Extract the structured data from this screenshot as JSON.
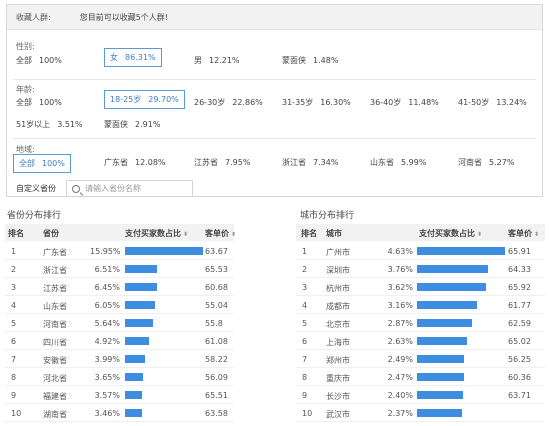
{
  "filter": {
    "header_title": "收藏人群:",
    "header_hint": "您目前可以收藏5个人群!",
    "gender": {
      "label": "性别:",
      "options": [
        {
          "name": "全部",
          "value": "100%"
        },
        {
          "name": "女",
          "value": "86.31%",
          "selected": true
        },
        {
          "name": "男",
          "value": "12.21%"
        },
        {
          "name": "蒙面侠",
          "value": "1.48%"
        }
      ]
    },
    "age": {
      "label": "年龄:",
      "options": [
        {
          "name": "全部",
          "value": "100%"
        },
        {
          "name": "18-25岁",
          "value": "29.70%",
          "selected": true
        },
        {
          "name": "26-30岁",
          "value": "22.86%"
        },
        {
          "name": "31-35岁",
          "value": "16.30%"
        },
        {
          "name": "36-40岁",
          "value": "11.48%"
        },
        {
          "name": "41-50岁",
          "value": "13.24%"
        },
        {
          "name": "51岁以上",
          "value": "3.51%"
        },
        {
          "name": "蒙面侠",
          "value": "2.91%"
        }
      ]
    },
    "region": {
      "label": "地域:",
      "options": [
        {
          "name": "全部",
          "value": "100%",
          "selected": true
        },
        {
          "name": "广东省",
          "value": "12.08%"
        },
        {
          "name": "江苏省",
          "value": "7.95%"
        },
        {
          "name": "浙江省",
          "value": "7.34%"
        },
        {
          "name": "山东省",
          "value": "5.99%"
        },
        {
          "name": "河南省",
          "value": "5.27%"
        }
      ]
    },
    "custom_province_label": "自定义省份",
    "search_placeholder": "请输入省份名称"
  },
  "province_table": {
    "title": "省份分布排行",
    "headers": {
      "rank": "排名",
      "name": "省份",
      "pct": "支付买家数占比",
      "price": "客单价"
    },
    "rows": [
      {
        "rank": "1",
        "name": "广东省",
        "pct": "15.95%",
        "pct_value": 15.95,
        "price": "63.67"
      },
      {
        "rank": "2",
        "name": "浙江省",
        "pct": "6.51%",
        "pct_value": 6.51,
        "price": "65.53"
      },
      {
        "rank": "3",
        "name": "江苏省",
        "pct": "6.45%",
        "pct_value": 6.45,
        "price": "60.68"
      },
      {
        "rank": "4",
        "name": "山东省",
        "pct": "6.05%",
        "pct_value": 6.05,
        "price": "55.04"
      },
      {
        "rank": "5",
        "name": "河南省",
        "pct": "5.64%",
        "pct_value": 5.64,
        "price": "55.8"
      },
      {
        "rank": "6",
        "name": "四川省",
        "pct": "4.92%",
        "pct_value": 4.92,
        "price": "61.08"
      },
      {
        "rank": "7",
        "name": "安徽省",
        "pct": "3.99%",
        "pct_value": 3.99,
        "price": "58.22"
      },
      {
        "rank": "8",
        "name": "河北省",
        "pct": "3.65%",
        "pct_value": 3.65,
        "price": "56.09"
      },
      {
        "rank": "9",
        "name": "福建省",
        "pct": "3.57%",
        "pct_value": 3.57,
        "price": "65.51"
      },
      {
        "rank": "10",
        "name": "湖南省",
        "pct": "3.46%",
        "pct_value": 3.46,
        "price": "63.58"
      }
    ]
  },
  "city_table": {
    "title": "城市分布排行",
    "headers": {
      "rank": "排名",
      "name": "城市",
      "pct": "支付买家数占比",
      "price": "客单价"
    },
    "rows": [
      {
        "rank": "1",
        "name": "广州市",
        "pct": "4.63%",
        "pct_value": 4.63,
        "price": "65.91"
      },
      {
        "rank": "2",
        "name": "深圳市",
        "pct": "3.76%",
        "pct_value": 3.76,
        "price": "64.33"
      },
      {
        "rank": "3",
        "name": "杭州市",
        "pct": "3.62%",
        "pct_value": 3.62,
        "price": "65.92"
      },
      {
        "rank": "4",
        "name": "成都市",
        "pct": "3.16%",
        "pct_value": 3.16,
        "price": "61.77"
      },
      {
        "rank": "5",
        "name": "北京市",
        "pct": "2.87%",
        "pct_value": 2.87,
        "price": "62.59"
      },
      {
        "rank": "6",
        "name": "上海市",
        "pct": "2.63%",
        "pct_value": 2.63,
        "price": "65.02"
      },
      {
        "rank": "7",
        "name": "郑州市",
        "pct": "2.49%",
        "pct_value": 2.49,
        "price": "56.25"
      },
      {
        "rank": "8",
        "name": "重庆市",
        "pct": "2.47%",
        "pct_value": 2.47,
        "price": "60.36"
      },
      {
        "rank": "9",
        "name": "长沙市",
        "pct": "2.40%",
        "pct_value": 2.4,
        "price": "63.71"
      },
      {
        "rank": "10",
        "name": "武汉市",
        "pct": "2.37%",
        "pct_value": 2.37,
        "price": ""
      }
    ]
  },
  "colors": {
    "accent": "#3d8de0",
    "selected_border": "#5b9bd5"
  }
}
